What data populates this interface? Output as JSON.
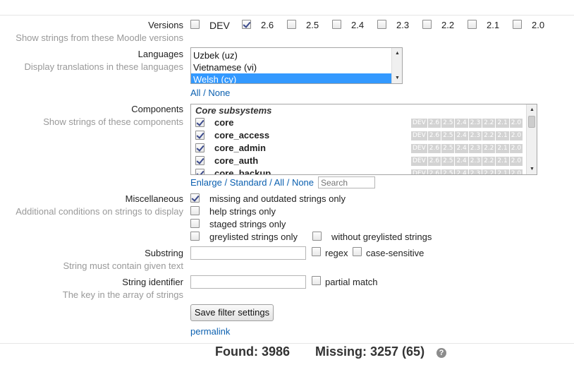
{
  "versions": {
    "label": "Versions",
    "description": "Show strings from these Moodle versions",
    "options": [
      {
        "label": "DEV",
        "checked": false
      },
      {
        "label": "2.6",
        "checked": true
      },
      {
        "label": "2.5",
        "checked": false
      },
      {
        "label": "2.4",
        "checked": false
      },
      {
        "label": "2.3",
        "checked": false
      },
      {
        "label": "2.2",
        "checked": false
      },
      {
        "label": "2.1",
        "checked": false
      },
      {
        "label": "2.0",
        "checked": false
      }
    ]
  },
  "languages": {
    "label": "Languages",
    "description": "Display translations in these languages",
    "options": [
      {
        "label": "Uzbek (uz)",
        "selected": false
      },
      {
        "label": "Vietnamese (vi)",
        "selected": false
      },
      {
        "label": "Welsh (cy)",
        "selected": true
      }
    ],
    "all_label": "All",
    "separator": "/",
    "none_label": "None"
  },
  "components": {
    "label": "Components",
    "description": "Show strings of these components",
    "group": "Core subsystems",
    "items": [
      {
        "name": "core",
        "checked": true
      },
      {
        "name": "core_access",
        "checked": true
      },
      {
        "name": "core_admin",
        "checked": true
      },
      {
        "name": "core_auth",
        "checked": true
      },
      {
        "name": "core_backup",
        "checked": true
      }
    ],
    "version_badges": [
      "DEV",
      "2.6",
      "2.5",
      "2.4",
      "2.3",
      "2.2",
      "2.1",
      "2.0"
    ],
    "enlarge_label": "Enlarge",
    "standard_label": "Standard",
    "all_label": "All",
    "none_label": "None",
    "separator": "/",
    "search_placeholder": "Search"
  },
  "misc": {
    "label": "Miscellaneous",
    "description": "Additional conditions on strings to display",
    "missing_label": "missing and outdated strings only",
    "missing_checked": true,
    "help_label": "help strings only",
    "staged_label": "staged strings only",
    "greylisted_label": "greylisted strings only",
    "without_greylisted_label": "without greylisted strings"
  },
  "substring": {
    "label": "Substring",
    "description": "String must contain given text",
    "value": "",
    "regex_label": "regex",
    "case_label": "case-sensitive"
  },
  "stringid": {
    "label": "String identifier",
    "description": "The key in the array of strings",
    "value": "",
    "partial_label": "partial match"
  },
  "save_label": "Save filter settings",
  "permalink_label": "permalink",
  "summary": {
    "found": "Found: 3986",
    "missing": "Missing: 3257 (65)",
    "help_glyph": "?"
  }
}
